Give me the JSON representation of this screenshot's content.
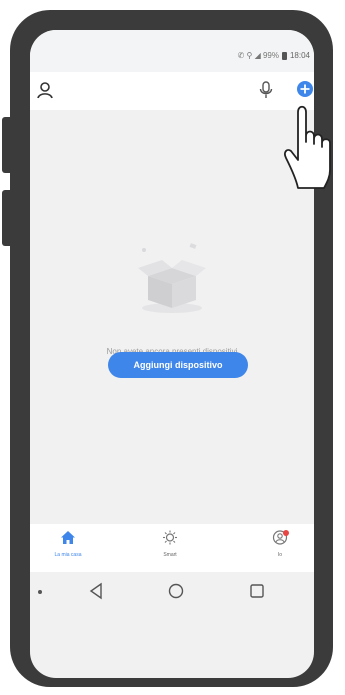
{
  "status_bar": {
    "indicators": "✆ ⚲ ◢ 99%",
    "time": "18:04"
  },
  "header": {
    "user_icon": "user-icon",
    "mic_icon": "microphone-icon",
    "add_icon": "add-circle-icon"
  },
  "main": {
    "empty_message": "Non avete ancora presenti dispositivi",
    "add_button_label": "Aggiungi dispositivo"
  },
  "tabs": [
    {
      "label": "La mia casa",
      "icon": "home-icon",
      "active": true
    },
    {
      "label": "Smart",
      "icon": "smart-sun-icon",
      "active": false
    },
    {
      "label": "Io",
      "icon": "profile-icon",
      "active": false,
      "badge": true
    }
  ],
  "colors": {
    "accent": "#3f86ea",
    "badge": "#e84545",
    "screen_bg": "#f1f1f2",
    "phone_frame": "#3b3b3b"
  }
}
